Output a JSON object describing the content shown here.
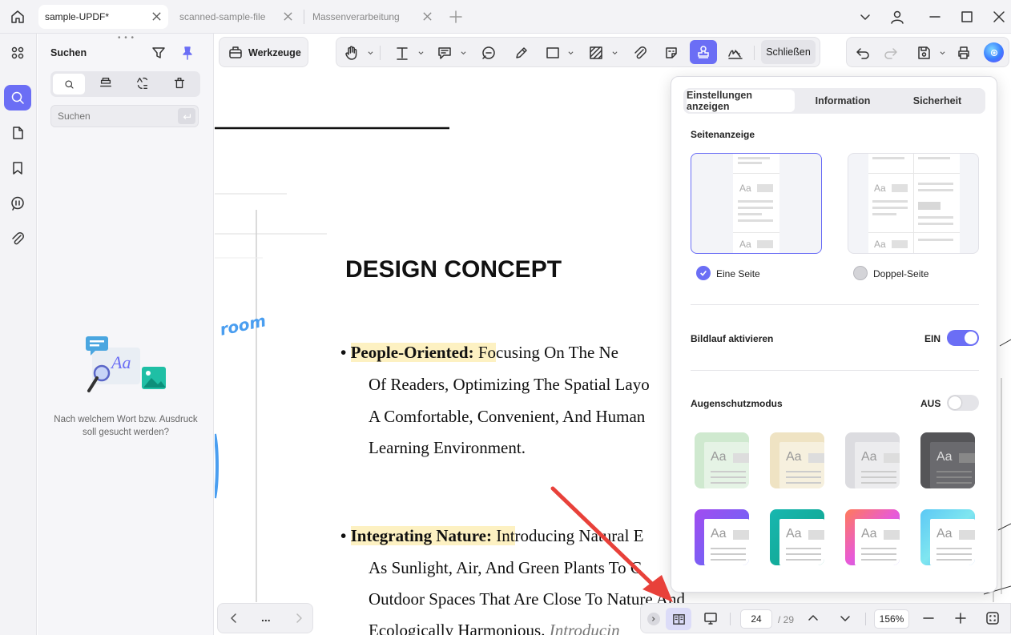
{
  "tabs": [
    {
      "label": "sample-UPDF*"
    },
    {
      "label": "scanned-sample-file"
    },
    {
      "label": "Massenverarbeitung"
    }
  ],
  "search": {
    "title": "Suchen",
    "placeholder": "Suchen",
    "empty_text_line1": "Nach welchem Wort bzw. Ausdruck",
    "empty_text_line2": "soll gesucht werden?"
  },
  "toolbar": {
    "tools_label": "Werkzeuge",
    "close_label": "Schließen"
  },
  "document": {
    "handwriting": "room",
    "heading": "DESIGN CONCEPT",
    "bullet1_bold": "People-Oriented:",
    "bullet1_hl_rest": " Fo",
    "bullet1_rest": "cusing On The         Ne",
    "bullet1_line2": "Of Readers, Optimizing The Spatial Layo",
    "bullet1_line3": "A Comfortable, Convenient, And Human",
    "bullet1_line4": "Learning Environment.",
    "bullet2_bold": "Integrating Nature:",
    "bullet2_hl_rest": " Int",
    "bullet2_rest": "roducing Natural E",
    "bullet2_line2": "As Sunlight, Air, And Green Plants To C",
    "bullet2_line3": "Outdoor Spaces That Are Close To Nature And",
    "bullet2_line4": "Ecologically Harmonious.",
    "bullet2_line4_italic": "Introducin"
  },
  "popup": {
    "tabs": [
      "Einstellungen anzeigen",
      "Information",
      "Sicherheit"
    ],
    "page_display_label": "Seitenanzeige",
    "single_page_label": "Eine Seite",
    "double_page_label": "Doppel-Seite",
    "scroll_label": "Bildlauf aktivieren",
    "scroll_state": "EIN",
    "eye_label": "Augenschutzmodus",
    "eye_state": "AUS",
    "theme_sample": "Aa",
    "colors": {
      "accent": "#6b6ef5"
    }
  },
  "pager": {
    "more": "...",
    "current_page": "24",
    "total_pages": "/ 29",
    "zoom": "156%"
  }
}
